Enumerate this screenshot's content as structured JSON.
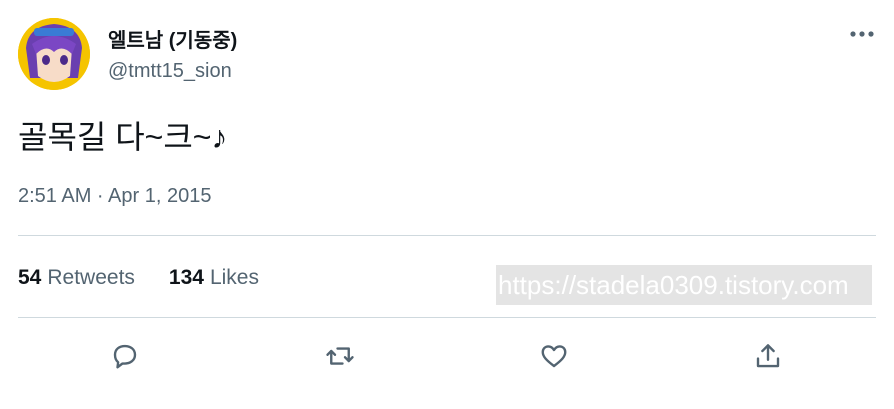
{
  "author": {
    "display_name": "엘트남 (기동중)",
    "handle": "@tmtt15_sion",
    "avatar_icon": "anime-avatar-icon"
  },
  "tweet": {
    "text": "골목길 다~크~♪",
    "timestamp": "2:51 AM · Apr 1, 2015"
  },
  "stats": {
    "retweets_count": "54",
    "retweets_label": "Retweets",
    "likes_count": "134",
    "likes_label": "Likes"
  },
  "watermark": "https://stadela0309.tistory.com",
  "actions": {
    "reply_icon": "reply-icon",
    "retweet_icon": "retweet-icon",
    "like_icon": "heart-icon",
    "share_icon": "share-icon"
  },
  "colors": {
    "text_primary": "#0f1419",
    "text_secondary": "#536471",
    "divider": "#cfd9de"
  }
}
